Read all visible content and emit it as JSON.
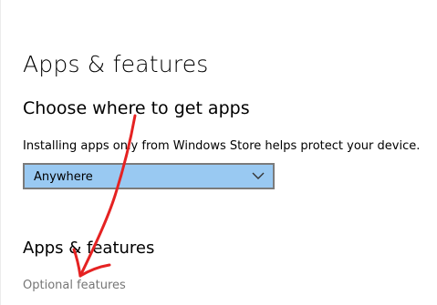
{
  "header": {
    "title": "Apps & features"
  },
  "install_source": {
    "heading": "Choose where to get apps",
    "description": "Installing apps only from Windows Store helps protect your device.",
    "selected_option": "Anywhere",
    "chevron_icon": "chevron-down-icon"
  },
  "apps_section": {
    "heading": "Apps & features",
    "optional_features_link": "Optional features"
  },
  "annotation": {
    "type": "hand-drawn red arrow",
    "color": "#e52222"
  },
  "colors": {
    "dropdown_background": "#99c9f2",
    "dropdown_border": "#7b7b7b",
    "link_gray": "#767676"
  }
}
